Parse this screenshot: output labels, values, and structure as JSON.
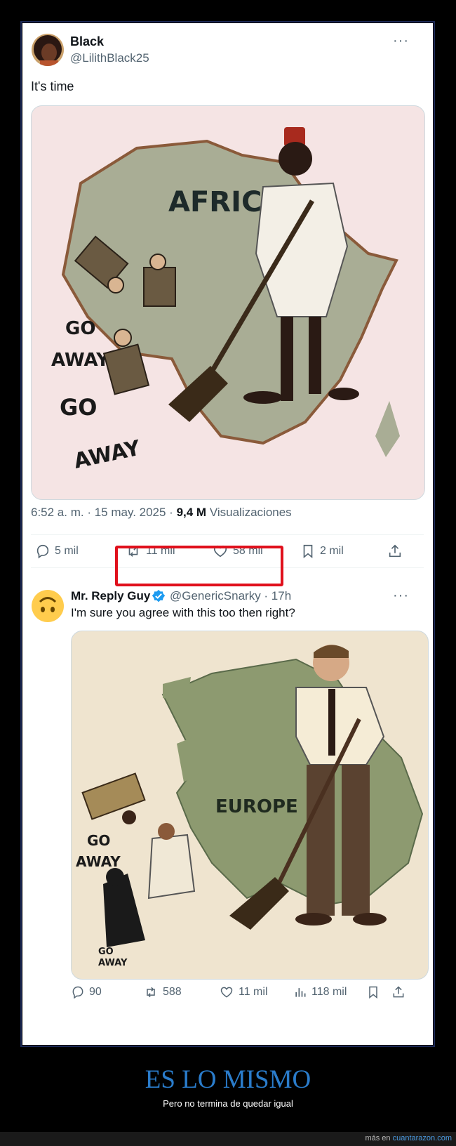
{
  "main_tweet": {
    "name": "Black",
    "handle": "@LilithBlack25",
    "text": "It's time",
    "image_text": {
      "title": "AFRICA",
      "go1": "GO",
      "away1": "AWAY",
      "go2": "GO",
      "away2": "AWAY"
    },
    "timestamp": "6:52 a. m. · 15 may. 2025 · ",
    "views_count": "9,4 M",
    "views_label": " Visualizaciones",
    "replies": "5 mil",
    "retweets": "11 mil",
    "likes": "58 mil",
    "bookmarks": "2 mil"
  },
  "reply_tweet": {
    "name": "Mr. Reply Guy",
    "handle": "@GenericSnarky · 17h",
    "text": "I'm sure you agree with this too then right?",
    "image_text": {
      "title": "EUROPE",
      "go1": "GO",
      "away1": "AWAY",
      "go2": "GO",
      "away2": "AWAY"
    },
    "replies": "90",
    "retweets": "588",
    "likes": "11 mil",
    "views": "118 mil"
  },
  "caption": {
    "title": "ES LO MISMO",
    "subtitle": "Pero no termina de quedar igual"
  },
  "footer": {
    "prefix": "más en ",
    "site": "cuantarazon.com"
  },
  "colors": {
    "highlight": "#e0101c",
    "caption": "#2a7ccb",
    "verified": "#1d9bf0"
  }
}
